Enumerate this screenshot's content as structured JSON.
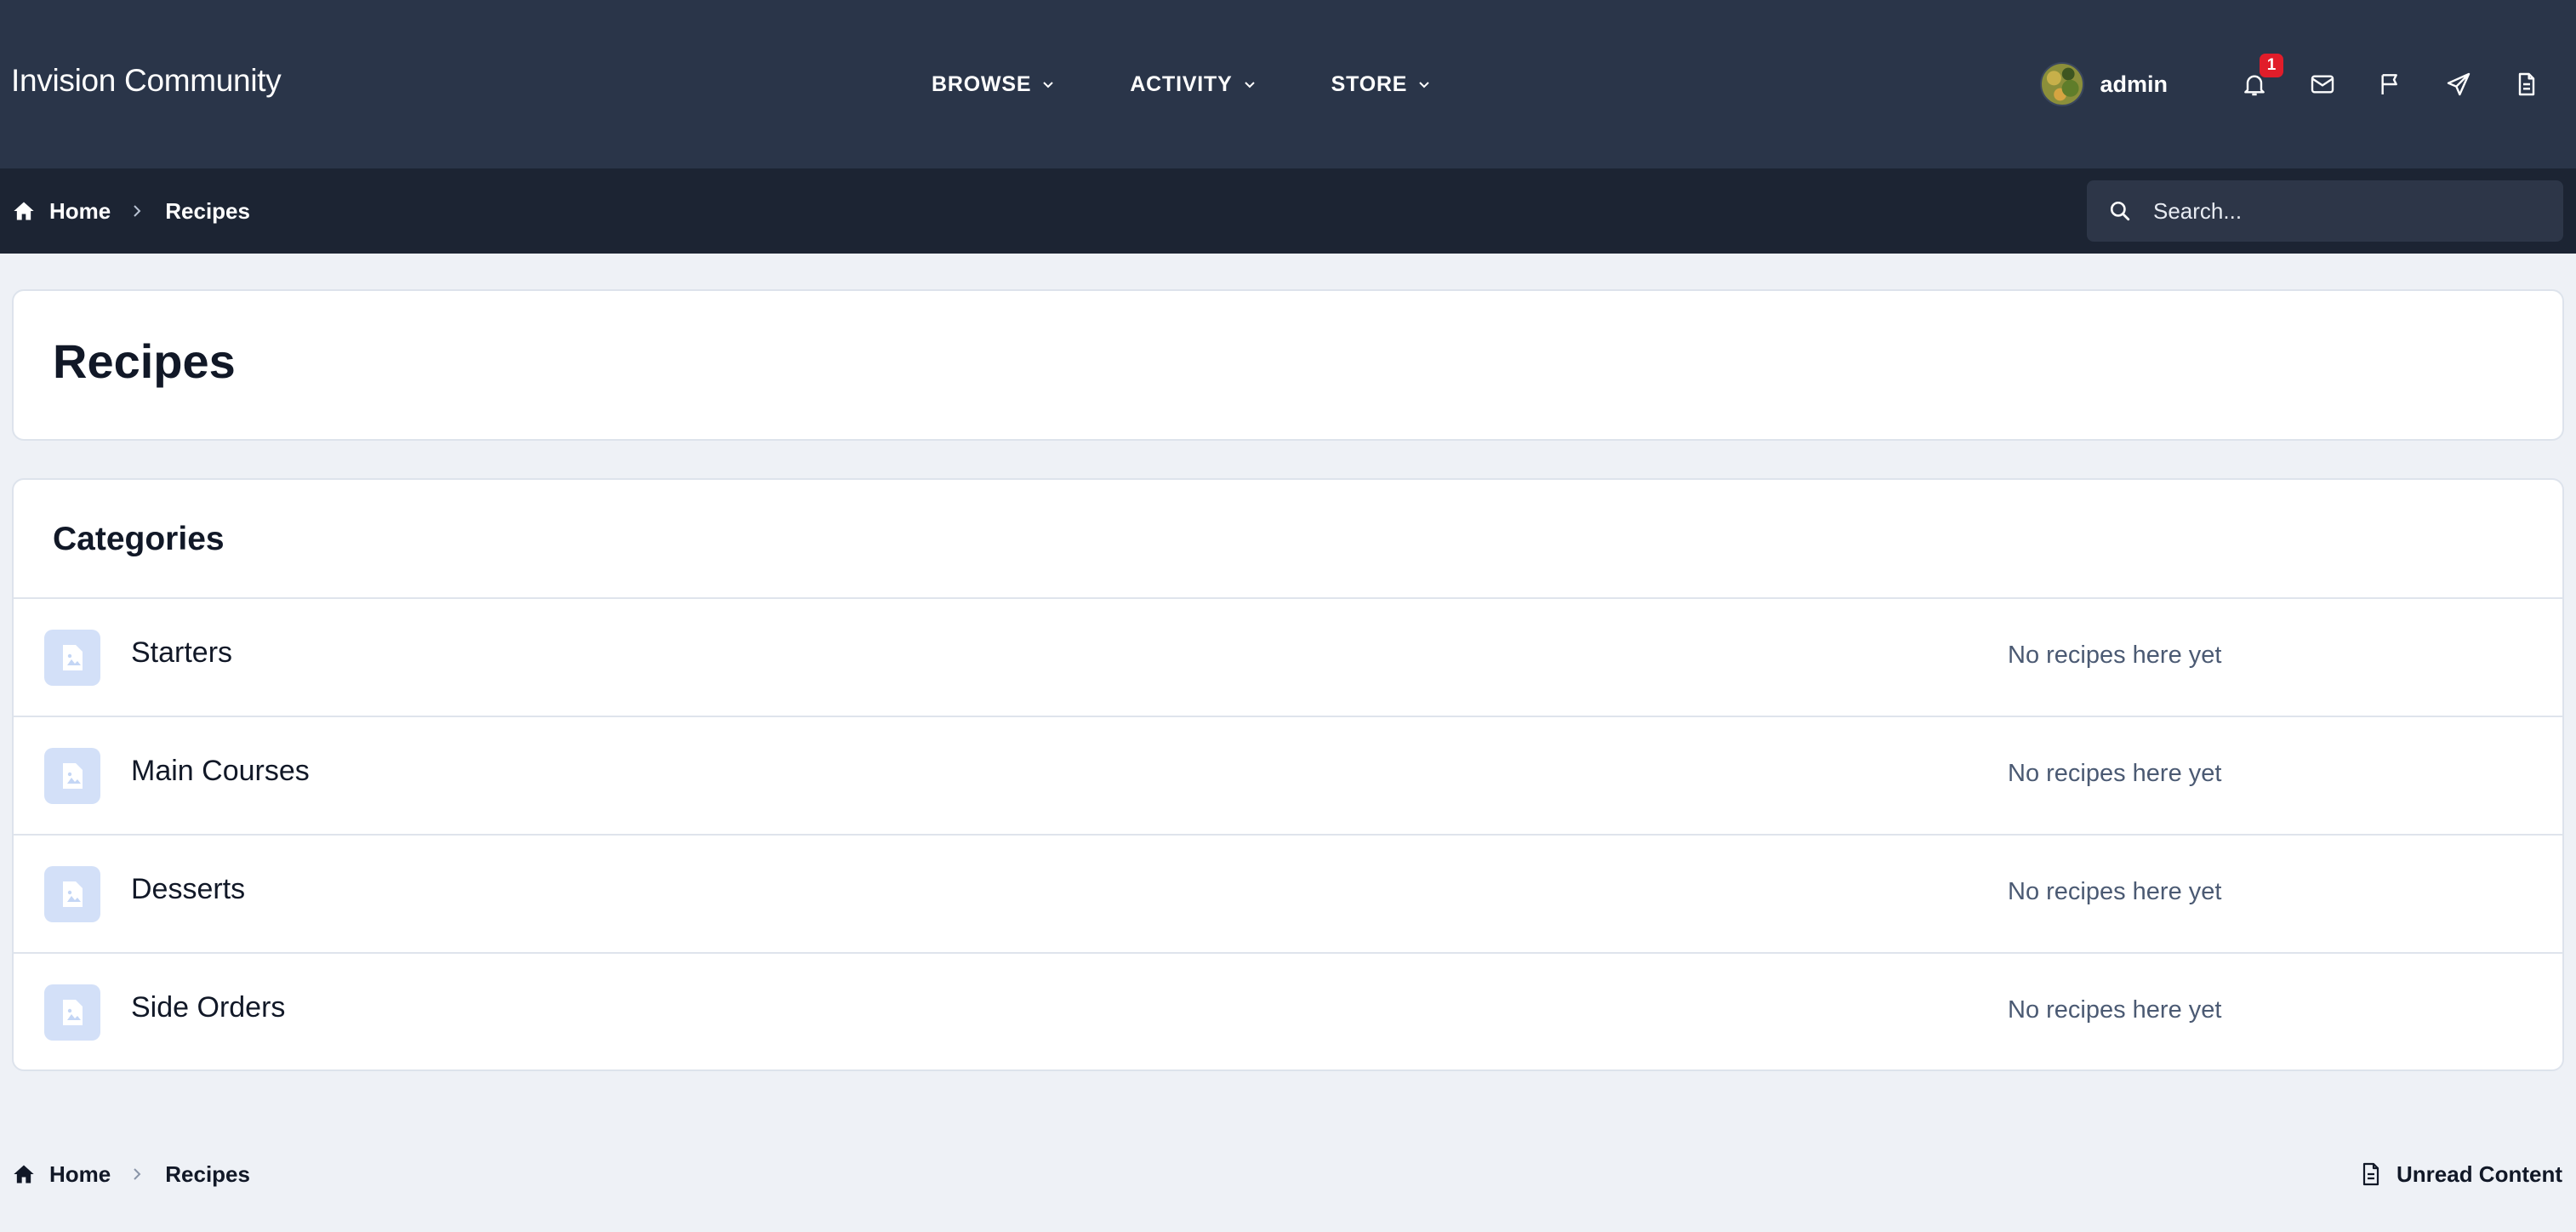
{
  "header": {
    "site_title": "Invision Community",
    "nav": [
      {
        "label": "BROWSE"
      },
      {
        "label": "ACTIVITY"
      },
      {
        "label": "STORE"
      }
    ],
    "user": {
      "name": "admin"
    },
    "notifications_count": "1",
    "icons": [
      "bell-icon",
      "envelope-icon",
      "flag-icon",
      "paper-plane-icon",
      "document-icon"
    ]
  },
  "breadcrumb": {
    "home": "Home",
    "current": "Recipes"
  },
  "search": {
    "placeholder": "Search..."
  },
  "page": {
    "title": "Recipes"
  },
  "categories": {
    "title": "Categories",
    "items": [
      {
        "name": "Starters",
        "status": "No recipes here yet"
      },
      {
        "name": "Main Courses",
        "status": "No recipes here yet"
      },
      {
        "name": "Desserts",
        "status": "No recipes here yet"
      },
      {
        "name": "Side Orders",
        "status": "No recipes here yet"
      }
    ]
  },
  "footer": {
    "home": "Home",
    "current": "Recipes",
    "unread_label": "Unread Content"
  },
  "colors": {
    "header_bg": "#2a3549",
    "breadcrumb_bg": "#1c2433",
    "page_bg": "#eef1f6",
    "badge": "#e11d2a",
    "category_icon_bg": "#d3e0f8"
  }
}
